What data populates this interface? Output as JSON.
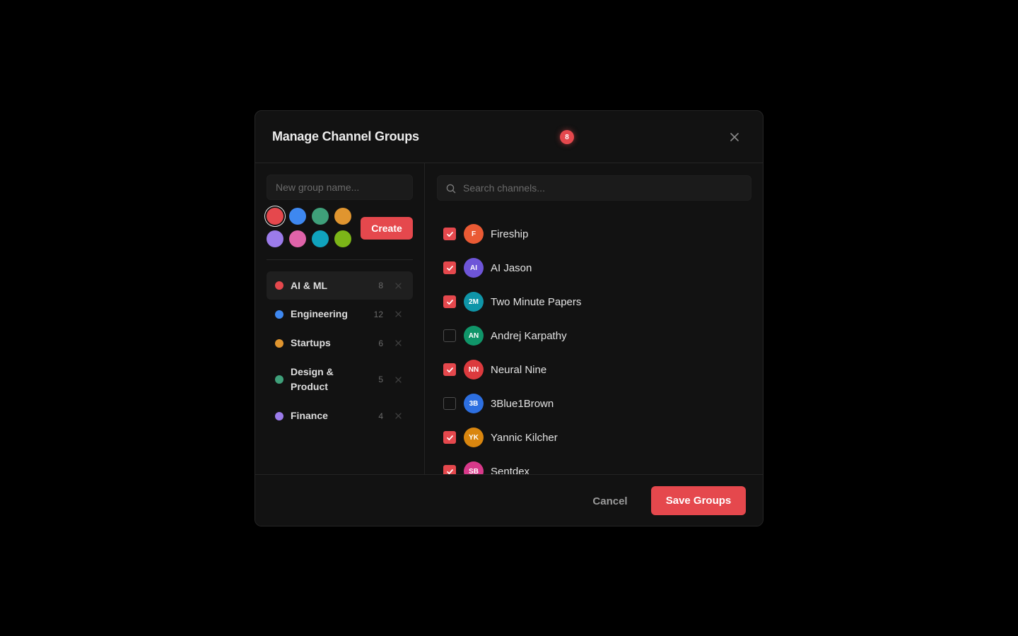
{
  "modal": {
    "title": "Manage Channel Groups",
    "badge_count": "8",
    "close_icon": "close-icon"
  },
  "new_group": {
    "placeholder": "New group name...",
    "create_label": "Create",
    "colors": [
      "#e5484d",
      "#3e88f0",
      "#3fa07a",
      "#e0952f",
      "#9b7bea",
      "#e063a9",
      "#10a3bd",
      "#7cb518"
    ],
    "selected_color": "#e5484d"
  },
  "groups": [
    {
      "name": "AI & ML",
      "count": "8",
      "color": "#e5484d",
      "active": true
    },
    {
      "name": "Engineering",
      "count": "12",
      "color": "#3e88f0",
      "active": false
    },
    {
      "name": "Startups",
      "count": "6",
      "color": "#e0952f",
      "active": false
    },
    {
      "name": "Design & Product",
      "count": "5",
      "color": "#3fa07a",
      "active": false
    },
    {
      "name": "Finance",
      "count": "4",
      "color": "#9b7bea",
      "active": false
    }
  ],
  "search": {
    "placeholder": "Search channels..."
  },
  "channels": [
    {
      "name": "Fireship",
      "initials": "F",
      "color": "#ea5a34",
      "checked": true
    },
    {
      "name": "AI Jason",
      "initials": "AI",
      "color": "#6e55d8",
      "checked": true
    },
    {
      "name": "Two Minute Papers",
      "initials": "2M",
      "color": "#0f95a8",
      "checked": true
    },
    {
      "name": "Andrej Karpathy",
      "initials": "AN",
      "color": "#109569",
      "checked": false
    },
    {
      "name": "Neural Nine",
      "initials": "NN",
      "color": "#dc3a3e",
      "checked": true
    },
    {
      "name": "3Blue1Brown",
      "initials": "3B",
      "color": "#2d6fe0",
      "checked": false
    },
    {
      "name": "Yannic Kilcher",
      "initials": "YK",
      "color": "#d9860f",
      "checked": true
    },
    {
      "name": "Sentdex",
      "initials": "SB",
      "color": "#d8398a",
      "checked": true
    }
  ],
  "footer": {
    "cancel_label": "Cancel",
    "save_label": "Save Groups"
  },
  "theme": {
    "accent": "#e5484d",
    "background": "#000000",
    "surface": "#121212"
  }
}
